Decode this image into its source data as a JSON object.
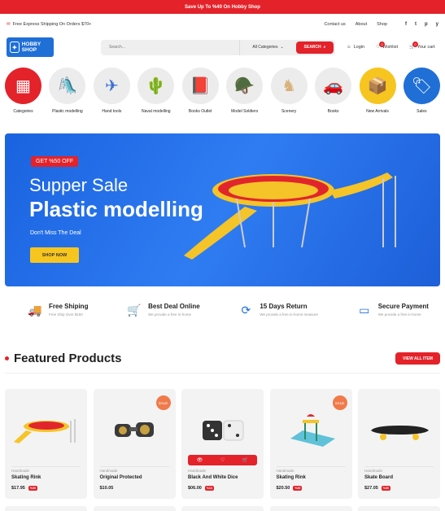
{
  "promo": {
    "text": "Save Up To %40 On Hobby Shop"
  },
  "topbar": {
    "shipping_text": "Free Express Shipping On Orders $70+",
    "links": [
      "Contact us",
      "About",
      "Shop"
    ],
    "social": [
      "f",
      "t",
      "p",
      "y"
    ]
  },
  "header": {
    "logo_text": "HOBBY SHOP",
    "search": {
      "placeholder": "Search...",
      "category": "All Categories",
      "button": "SEARCH"
    },
    "login": "Login",
    "wishlist": "Wishlist",
    "wishlist_count": "0",
    "cart": "Your cart",
    "cart_count": "0"
  },
  "categories": [
    {
      "label": "Categories",
      "icon": "grid-icon"
    },
    {
      "label": "Plastic modelling",
      "icon": "slide-icon"
    },
    {
      "label": "Hand tools",
      "icon": "origami-icon"
    },
    {
      "label": "Naval modelling",
      "icon": "plant-icon"
    },
    {
      "label": "Books Outlet",
      "icon": "book-icon"
    },
    {
      "label": "Model Soldiers",
      "icon": "soldier-icon"
    },
    {
      "label": "Scenery",
      "icon": "chess-icon"
    },
    {
      "label": "Books",
      "icon": "car-icon"
    },
    {
      "label": "New Arrivals",
      "icon": "box-icon"
    },
    {
      "label": "Sales",
      "icon": "tag-icon"
    }
  ],
  "hero": {
    "tag": "GET %50 OFF",
    "title_light": "Supper Sale",
    "title_bold": "Plastic modelling",
    "subtitle": "Don't Miss The Deal",
    "button": "SHOP NOW"
  },
  "features": [
    {
      "title": "Free Shiping",
      "sub": "Free Ship Over $150"
    },
    {
      "title": "Best Deal Online",
      "sub": "We provide a free in-home"
    },
    {
      "title": "15 Days Return",
      "sub": "We provide a free in-home measure"
    },
    {
      "title": "Secure Payment",
      "sub": "We provide a free in-home"
    }
  ],
  "featured": {
    "title": "Featured Products",
    "view_all": "VIEW ALL ITEM"
  },
  "products": [
    {
      "brand": "Handmade",
      "name": "Skating Rink",
      "price": "$17.95",
      "off": "%30",
      "sale": ""
    },
    {
      "brand": "Handmade",
      "name": "Original Protected",
      "price": "$10.05",
      "off": "",
      "sale": "SALE"
    },
    {
      "brand": "Handmade",
      "name": "Black And White Dice",
      "price": "$06.00",
      "off": "%14",
      "sale": ""
    },
    {
      "brand": "Handmade",
      "name": "Skating Rink",
      "price": "$20.50",
      "off": "%30",
      "sale": "SALE"
    },
    {
      "brand": "Handmade",
      "name": "Skate Board",
      "price": "$27.05",
      "off": "%30",
      "sale": ""
    }
  ],
  "colors": {
    "accent": "#e3222a",
    "brand_blue": "#1f6fd6",
    "hero_blue": "#2f7cf2",
    "yellow": "#f7c520"
  }
}
